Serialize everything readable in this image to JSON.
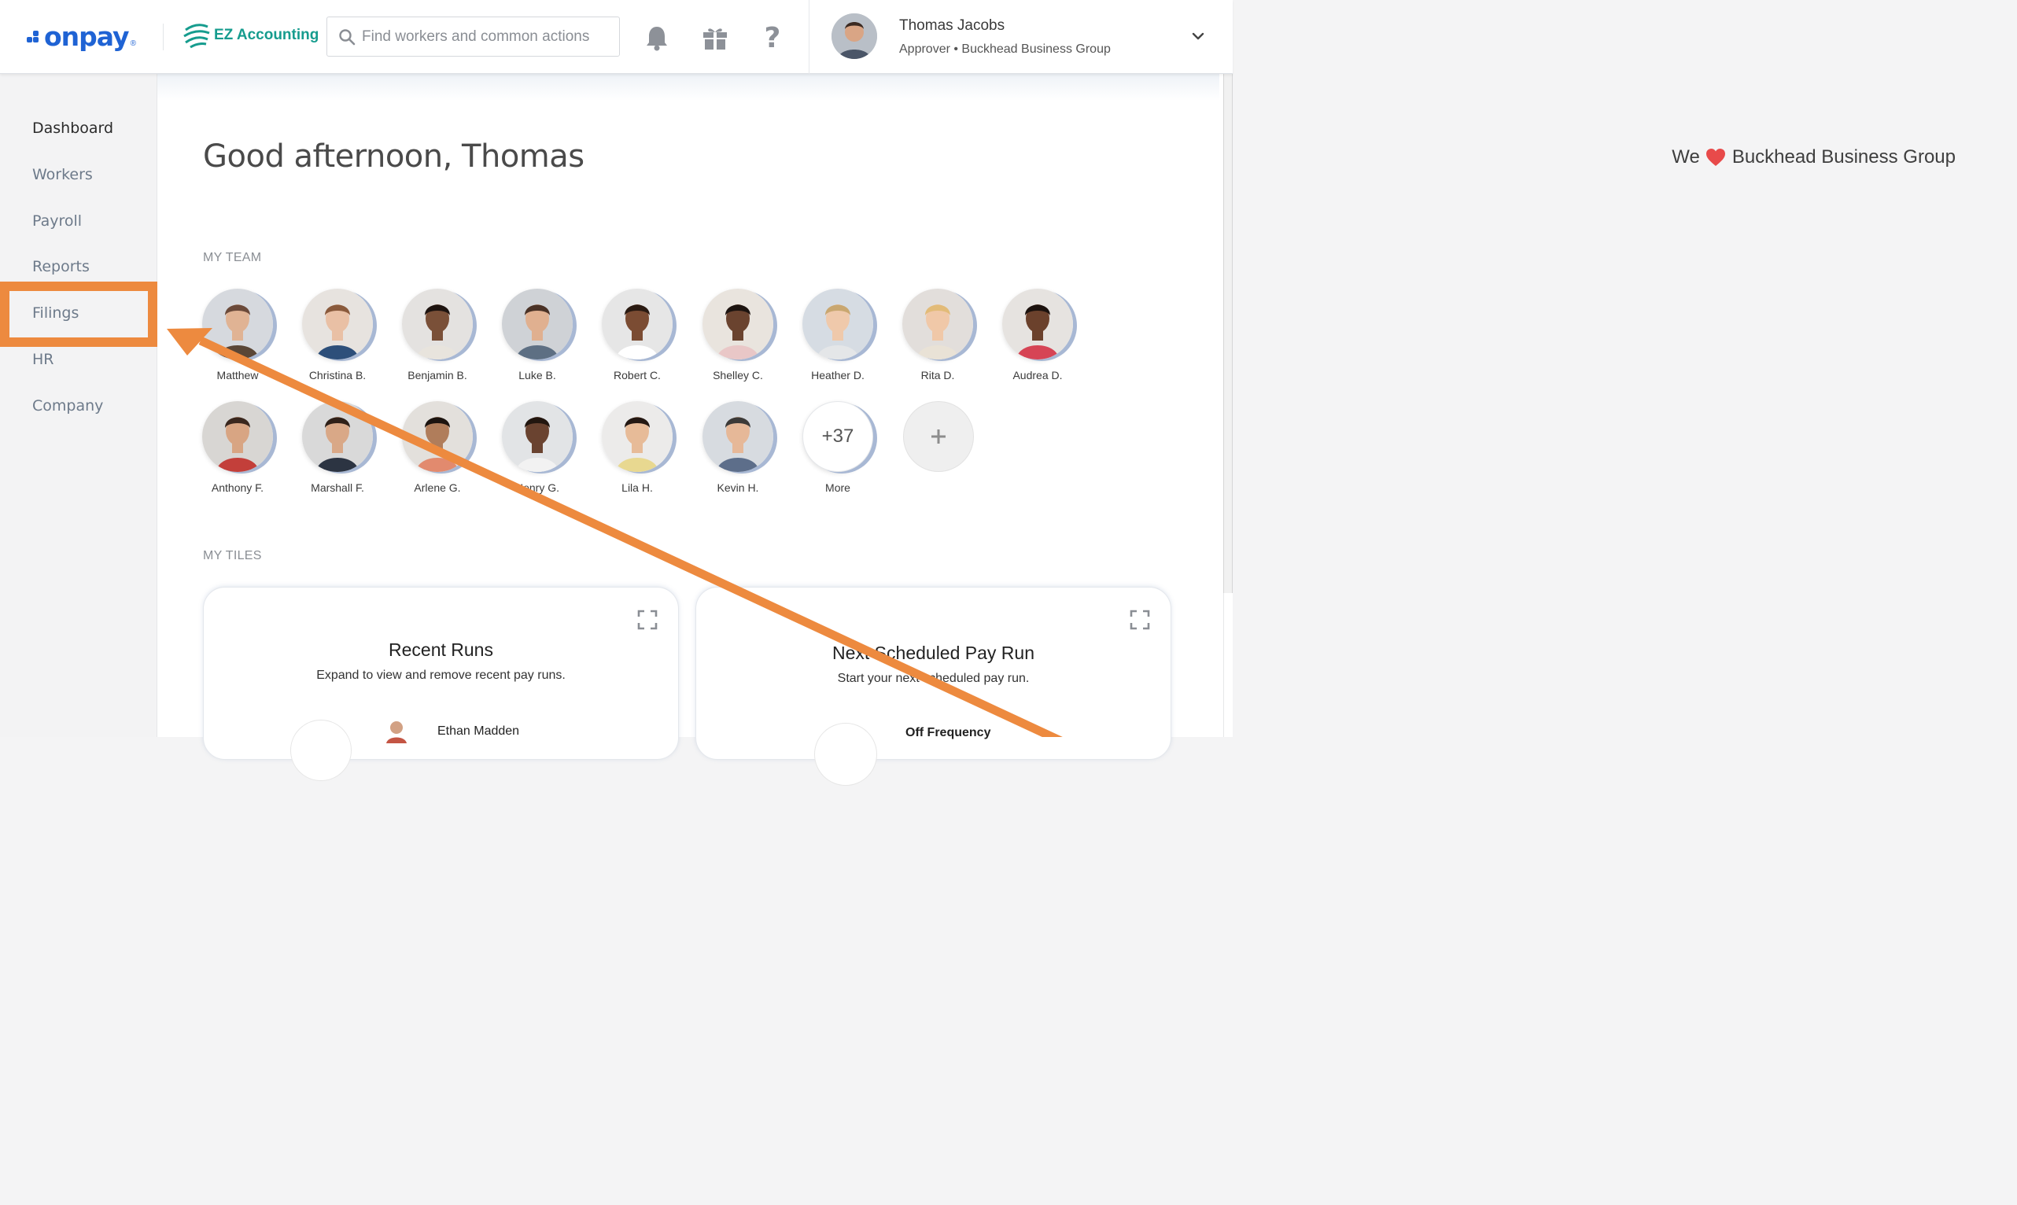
{
  "header": {
    "logo_text": "onpay",
    "logo_mark": "®",
    "ez_label": "EZ Accounting",
    "search_placeholder": "Find workers and common actions",
    "icons": [
      "bell-icon",
      "gift-icon",
      "help-icon"
    ],
    "help_glyph": "?",
    "user": {
      "name": "Thomas Jacobs",
      "role": "Approver • Buckhead Business Group"
    }
  },
  "sidebar": {
    "items": [
      {
        "label": "Dashboard",
        "active": true
      },
      {
        "label": "Workers"
      },
      {
        "label": "Payroll"
      },
      {
        "label": "Reports"
      },
      {
        "label": "Filings",
        "highlighted": true
      },
      {
        "label": "HR"
      },
      {
        "label": "Company"
      }
    ]
  },
  "main": {
    "greeting": "Good afternoon, Thomas",
    "we_love": {
      "prefix": "We",
      "company": "Buckhead Business Group"
    },
    "team_label": "MY TEAM",
    "team": [
      "Matthew",
      "Christina B.",
      "Benjamin B.",
      "Luke B.",
      "Robert C.",
      "Shelley C.",
      "Heather D.",
      "Rita D.",
      "Audrea D.",
      "Anthony F.",
      "Marshall F.",
      "Arlene G.",
      "Henry G.",
      "Lila H.",
      "Kevin H."
    ],
    "more": {
      "count": "+37",
      "label": "More"
    },
    "add_glyph": "+",
    "tiles_label": "MY TILES",
    "tiles": [
      {
        "title": "Recent Runs",
        "subtitle": "Expand to view and remove recent pay runs.",
        "row_text": "Ethan Madden"
      },
      {
        "title": "Next Scheduled Pay Run",
        "subtitle": "Start your next scheduled pay run.",
        "row_text": "Off Frequency"
      }
    ]
  },
  "colors": {
    "brand": "#1f63d4",
    "ez": "#169c8e",
    "annotation": "#ed8a3f",
    "heart": "#e84a4a"
  }
}
